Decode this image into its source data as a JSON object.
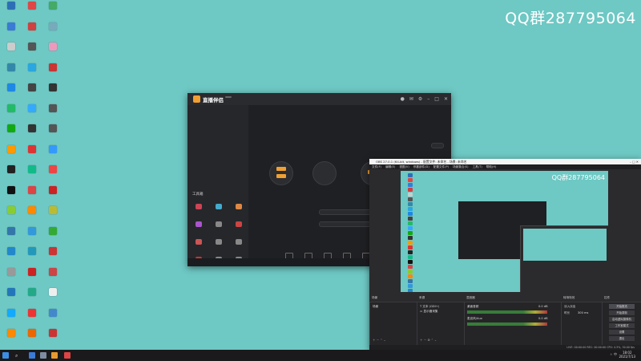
{
  "watermark": "QQ群287795064",
  "desktop_icons": [
    {
      "label": "",
      "color": "#2d6fb6"
    },
    {
      "label": "",
      "color": "#e04646"
    },
    {
      "label": "",
      "color": "#4a6"
    },
    {
      "label": "",
      "color": "#3a7bd5"
    },
    {
      "label": "",
      "color": "#d04040"
    },
    {
      "label": "",
      "color": "#7ab"
    },
    {
      "label": "",
      "color": "#ccc"
    },
    {
      "label": "",
      "color": "#555"
    },
    {
      "label": "",
      "color": "#e9b"
    },
    {
      "label": "",
      "color": "#38a"
    },
    {
      "label": "",
      "color": "#2aa7e0"
    },
    {
      "label": "",
      "color": "#c33"
    },
    {
      "label": "",
      "color": "#1e88e5"
    },
    {
      "label": "",
      "color": "#444"
    },
    {
      "label": "",
      "color": "#333"
    },
    {
      "label": "",
      "color": "#2b6"
    },
    {
      "label": "",
      "color": "#3af"
    },
    {
      "label": "",
      "color": "#555"
    },
    {
      "label": "",
      "color": "#1a1"
    },
    {
      "label": "",
      "color": "#333"
    },
    {
      "label": "",
      "color": "#555"
    },
    {
      "label": "",
      "color": "#f90"
    },
    {
      "label": "",
      "color": "#d33"
    },
    {
      "label": "",
      "color": "#39f"
    },
    {
      "label": "",
      "color": "#222"
    },
    {
      "label": "",
      "color": "#1b8"
    },
    {
      "label": "",
      "color": "#e44"
    },
    {
      "label": "",
      "color": "#111"
    },
    {
      "label": "",
      "color": "#d44"
    },
    {
      "label": "",
      "color": "#c22"
    },
    {
      "label": "",
      "color": "#8c3"
    },
    {
      "label": "",
      "color": "#f80"
    },
    {
      "label": "",
      "color": "#bb3"
    },
    {
      "label": "",
      "color": "#37a"
    },
    {
      "label": "",
      "color": "#39d"
    },
    {
      "label": "",
      "color": "#3a3"
    },
    {
      "label": "",
      "color": "#28c"
    },
    {
      "label": "",
      "color": "#29b"
    },
    {
      "label": "",
      "color": "#c33"
    },
    {
      "label": "",
      "color": "#999"
    },
    {
      "label": "",
      "color": "#c22"
    },
    {
      "label": "",
      "color": "#c44"
    },
    {
      "label": "",
      "color": "#27b"
    },
    {
      "label": "",
      "color": "#2a8"
    },
    {
      "label": "",
      "color": "#eee"
    },
    {
      "label": "",
      "color": "#1af"
    },
    {
      "label": "",
      "color": "#e33"
    },
    {
      "label": "",
      "color": "#48c"
    },
    {
      "label": "",
      "color": "#f80"
    },
    {
      "label": "",
      "color": "#e60"
    },
    {
      "label": "",
      "color": "#c33"
    }
  ],
  "streamer": {
    "brand": "直播伴侣",
    "badge": "",
    "left_tabs": [
      "",
      "",
      ""
    ],
    "empty_hint": "",
    "tools_title": "工具箱",
    "tools": [
      {
        "label": "",
        "color": "#c45"
      },
      {
        "label": "",
        "color": "#4ac"
      },
      {
        "label": "",
        "color": "#d84"
      },
      {
        "label": "",
        "color": "#a5c"
      },
      {
        "label": "",
        "color": "#888"
      },
      {
        "label": "",
        "color": "#c44"
      },
      {
        "label": "",
        "color": "#c55"
      },
      {
        "label": "",
        "color": "#888"
      },
      {
        "label": "",
        "color": "#888"
      },
      {
        "label": "",
        "color": "#c33"
      },
      {
        "label": "",
        "color": "#888"
      },
      {
        "label": "",
        "color": "#888"
      }
    ],
    "room_title": "",
    "mode_label": "",
    "mode_button": "",
    "field_labels": [
      "",
      ""
    ],
    "start_label": "",
    "bottom_status": ""
  },
  "obs": {
    "window_title": "OBS 27.0.1 (64-bit, windows) - 配置文件: 未命名 - 场景: 未命名",
    "menu": [
      "文件(F)",
      "编辑(E)",
      "视图(V)",
      "停靠部件(D)",
      "配置文件(P)",
      "场景集合(S)",
      "工具(T)",
      "帮助(H)"
    ],
    "preview_watermark": "QQ群287795064",
    "docks": [
      "场景",
      "来源",
      "混音器",
      "转场特效",
      "控件"
    ],
    "scenes": [
      "场景"
    ],
    "sources": [
      "文本 (GDI+)",
      "显示器采集"
    ],
    "mixer": [
      {
        "name": "桌面音频",
        "db": "0.0 dB"
      },
      {
        "name": "麦克风/Aux",
        "db": "0.0 dB"
      }
    ],
    "transition": {
      "type": "淡入淡出",
      "duration_label": "时长",
      "duration": "300 ms"
    },
    "controls": [
      "开始推流",
      "开始录制",
      "启动虚拟摄像机",
      "工作室模式",
      "设置",
      "退出"
    ],
    "status": "LIVE: 00:00:00  REC: 00:00:00  CPU: 4.5%, 30.00 fps"
  },
  "taskbar": {
    "time": "18:02",
    "date": "2021/7/13",
    "tray": "ㅅ  中"
  }
}
